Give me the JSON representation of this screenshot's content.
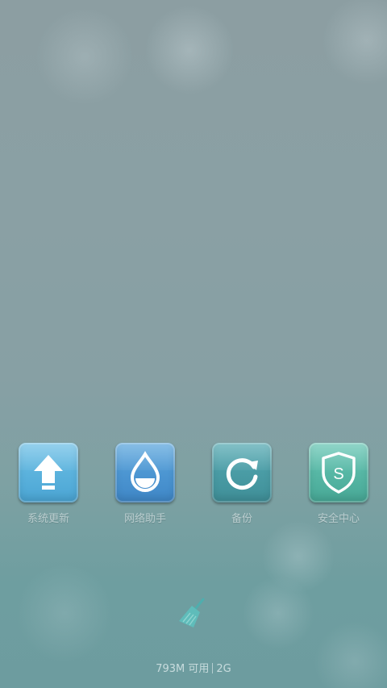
{
  "apps": [
    {
      "label": "系统更新",
      "icon": "up-arrow-icon"
    },
    {
      "label": "网络助手",
      "icon": "water-drop-icon"
    },
    {
      "label": "备份",
      "icon": "refresh-icon"
    },
    {
      "label": "安全中心",
      "icon": "shield-icon"
    }
  ],
  "security_letter": "S",
  "cleaner_icon": "broom-icon",
  "memory": {
    "available": "793M 可用",
    "total": "2G"
  }
}
